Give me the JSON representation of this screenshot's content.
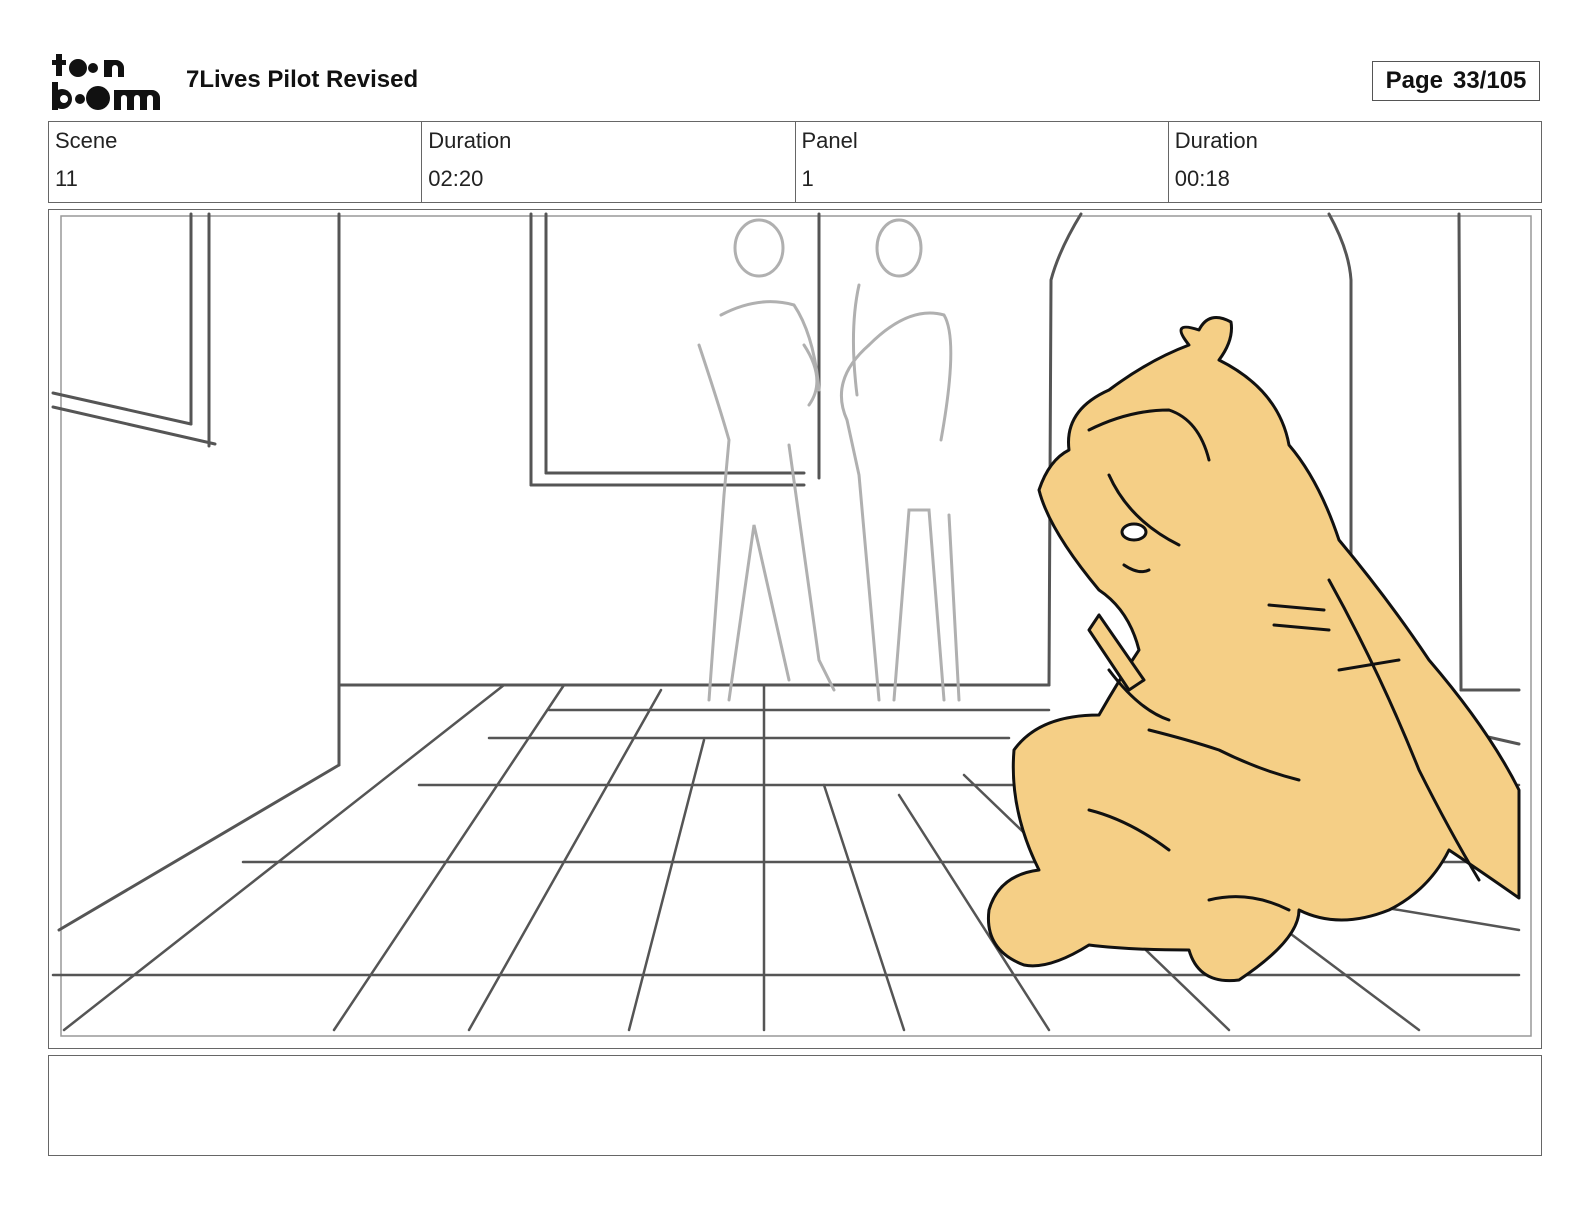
{
  "header": {
    "logo_text_top": "toon",
    "logo_text_bottom": "boom",
    "title": "7Lives Pilot Revised",
    "page_label": "Page",
    "page_value": "33/105"
  },
  "info": [
    {
      "label": "Scene",
      "value": "11"
    },
    {
      "label": "Duration",
      "value": "02:20"
    },
    {
      "label": "Panel",
      "value": "1"
    },
    {
      "label": "Duration",
      "value": "00:18"
    }
  ],
  "colors": {
    "sketch_line": "#555555",
    "background_figures": "#b0b0b0",
    "character_fill": "#f5cf86",
    "character_line": "#111111"
  },
  "notes": {
    "text": ""
  }
}
